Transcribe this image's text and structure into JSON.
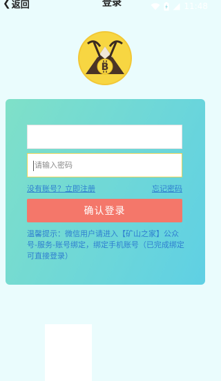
{
  "header": {
    "back_label": "返回",
    "title": "登录"
  },
  "status_bar": {
    "time": "11:48"
  },
  "logo": {
    "icon": "bitcoin-mining-logo-icon"
  },
  "form": {
    "username_value": "",
    "password_placeholder": "请输入密码",
    "register_link": "没有账号？立即注册",
    "forgot_link": "忘记密码",
    "submit_label": "确认登录",
    "tip": "温馨提示：微信用户请进入【矿山之家】公众号-服务-账号绑定，绑定手机账号（已完成绑定可直接登录）"
  },
  "colors": {
    "background": "#eafcfd",
    "card_gradient_start": "#7fe0c8",
    "card_gradient_end": "#5fd0e4",
    "submit_button": "#f4776a",
    "link": "#2f7fd0",
    "logo_yellow": "#f7d642"
  }
}
